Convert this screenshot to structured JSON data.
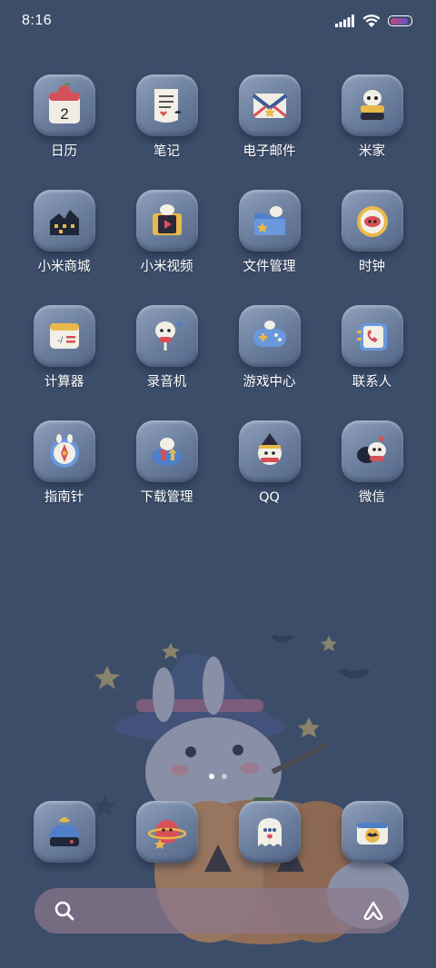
{
  "status_bar": {
    "time": "8:16",
    "battery_level": 0.9,
    "battery_colors": [
      "#c14a78",
      "#6a4fc8"
    ]
  },
  "apps": [
    {
      "label": "日历",
      "icon": "calendar-icon",
      "day": "2"
    },
    {
      "label": "笔记",
      "icon": "notes-icon"
    },
    {
      "label": "电子邮件",
      "icon": "mail-icon"
    },
    {
      "label": "米家",
      "icon": "mi-home-icon"
    },
    {
      "label": "小米商城",
      "icon": "store-icon"
    },
    {
      "label": "小米视频",
      "icon": "video-icon"
    },
    {
      "label": "文件管理",
      "icon": "folder-icon"
    },
    {
      "label": "时钟",
      "icon": "clock-icon"
    },
    {
      "label": "计算器",
      "icon": "calculator-icon"
    },
    {
      "label": "录音机",
      "icon": "recorder-icon"
    },
    {
      "label": "游戏中心",
      "icon": "gamepad-icon"
    },
    {
      "label": "联系人",
      "icon": "contacts-icon"
    },
    {
      "label": "指南针",
      "icon": "compass-icon"
    },
    {
      "label": "下载管理",
      "icon": "download-cloud-icon"
    },
    {
      "label": "QQ",
      "icon": "qq-ghost-icon"
    },
    {
      "label": "微信",
      "icon": "wechat-icon"
    }
  ],
  "page_indicator": {
    "count": 2,
    "active": 1
  },
  "dock": [
    {
      "icon": "phone-icon"
    },
    {
      "icon": "browser-planet-icon"
    },
    {
      "icon": "messages-ghost-icon"
    },
    {
      "icon": "camera-icon"
    }
  ],
  "search": {
    "icon": "search-icon",
    "assistant_icon": "assistant-icon"
  },
  "colors": {
    "background": "#3c4d6a",
    "tile": "#7386a6",
    "search_bar": "#8c788c"
  }
}
